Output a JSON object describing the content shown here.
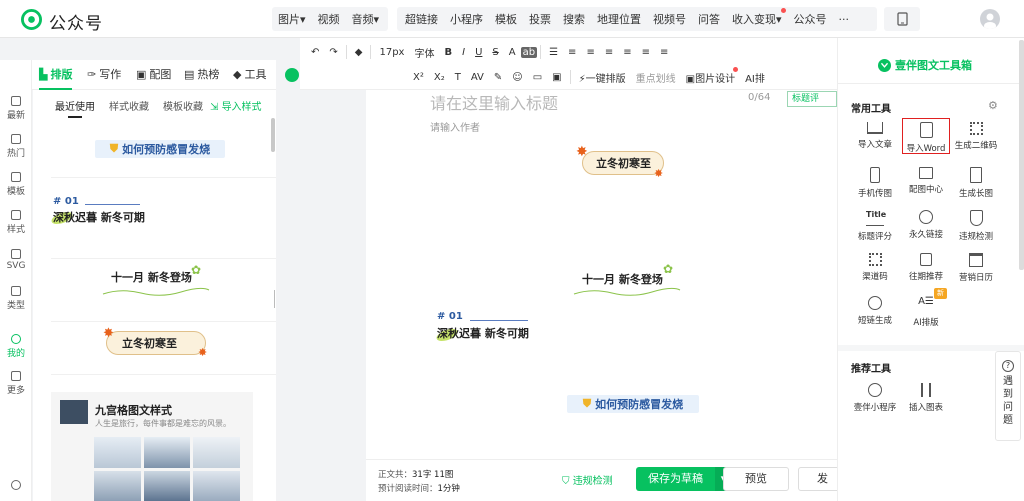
{
  "brand": {
    "name": "公众号"
  },
  "topmenu": {
    "group1": [
      "图片",
      "视频",
      "音频"
    ],
    "group2": [
      "超链接",
      "小程序",
      "模板",
      "投票",
      "搜索",
      "地理位置",
      "视频号",
      "问答",
      "收入变现",
      "公众号",
      "···"
    ]
  },
  "lefttabs": [
    {
      "label": "排版"
    },
    {
      "label": "写作"
    },
    {
      "label": "配图"
    },
    {
      "label": "热榜"
    },
    {
      "label": "工具"
    }
  ],
  "rail": [
    {
      "label": "最新"
    },
    {
      "label": "热门"
    },
    {
      "label": "模板"
    },
    {
      "label": "样式"
    },
    {
      "label": "SVG"
    },
    {
      "label": "类型"
    },
    {
      "label": "我的"
    },
    {
      "label": "更多"
    }
  ],
  "subtabs": [
    "最近使用",
    "样式收藏",
    "模板收藏",
    "导入样式"
  ],
  "templates": {
    "flu": "如何预防感冒发烧",
    "num": "# 01",
    "autumn": "深秋迟暮 新冬可期",
    "november": "十一月 新冬登场",
    "winter": "立冬初寒至",
    "grid_title": "九宫格图文样式",
    "grid_sub": "人生是旅行，每件事都是难忘的风景。"
  },
  "toolbar": {
    "row1": [
      "↶",
      "↷",
      "◆",
      "17px",
      "字体",
      "B",
      "I",
      "U",
      "S",
      "A",
      "ab",
      "☰",
      "≡",
      "≡",
      "≡",
      "≡",
      "≡",
      "≡"
    ],
    "row2": [
      "X²",
      "X₂",
      "T",
      "AV",
      "✎",
      "☺",
      "▭",
      "▣",
      "一键排版",
      "重点划线",
      "图片设计",
      "AI排"
    ]
  },
  "editor": {
    "title_placeholder": "请在这里输入标题",
    "title_count": "0/64",
    "author_placeholder": "请输入作者",
    "title_eval": "标题评"
  },
  "bottom": {
    "word_count_label": "正文共：",
    "word_count": "31字 11图",
    "read_time_label": "预计阅读时间：",
    "read_time": "1分钟",
    "compliance": "违规检测",
    "save": "保存为草稿",
    "preview": "预览",
    "publish": "发"
  },
  "rightpanel": {
    "title": "壹伴图文工具箱",
    "section1": "常用工具",
    "tools": [
      "导入文章",
      "导入Word",
      "生成二维码",
      "手机传图",
      "配图中心",
      "生成长图",
      "标题评分",
      "永久链接",
      "违规检测",
      "渠道码",
      "往期推荐",
      "营销日历",
      "短链生成",
      "AI排版"
    ],
    "new_badge": "新",
    "section2": "推荐工具",
    "tools2": [
      "壹伴小程序",
      "插入图表"
    ]
  },
  "float": {
    "text": "遇到问题"
  },
  "colors": {
    "accent": "#07c160",
    "highlight": "#e02020",
    "red_dot": "#fa5151"
  }
}
